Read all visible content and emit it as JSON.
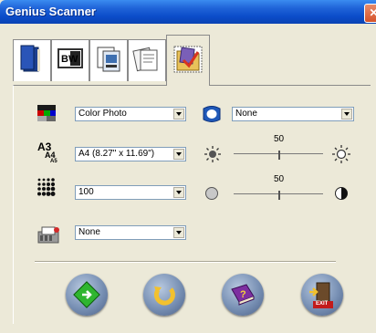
{
  "window": {
    "title": "Genius Scanner",
    "close_glyph": "✕"
  },
  "tabs": [
    {
      "icon": "book-icon"
    },
    {
      "icon": "black-white-icon",
      "label": "BW"
    },
    {
      "icon": "scanner-copy-icon"
    },
    {
      "icon": "documents-icon"
    },
    {
      "icon": "folder-check-icon",
      "active": true
    }
  ],
  "settings": {
    "image_type": {
      "icon": "color-palette-icon",
      "value": "Color Photo"
    },
    "page_size": {
      "icon": "paper-size-icon",
      "value": "A4 (8.27\" x 11.69\")"
    },
    "resolution": {
      "icon": "dots-grid-icon",
      "value": "100"
    },
    "destination": {
      "icon": "printer-folder-icon",
      "value": "None"
    },
    "filter": {
      "icon": "camera-lens-icon",
      "value": "None"
    }
  },
  "brightness": {
    "value": "50",
    "level": 0.5
  },
  "contrast": {
    "value": "50",
    "level": 0.5
  },
  "buttons": [
    {
      "name": "scan-button",
      "icon": "scan-go-icon"
    },
    {
      "name": "undo-button",
      "icon": "undo-arrow-icon"
    },
    {
      "name": "help-button",
      "icon": "help-book-icon"
    },
    {
      "name": "exit-button",
      "icon": "exit-door-icon",
      "label": "EXIT"
    }
  ],
  "colors": {
    "titlebar": "#0b4cc9",
    "face": "#ece9d8",
    "button_blue": "#7890b4"
  }
}
